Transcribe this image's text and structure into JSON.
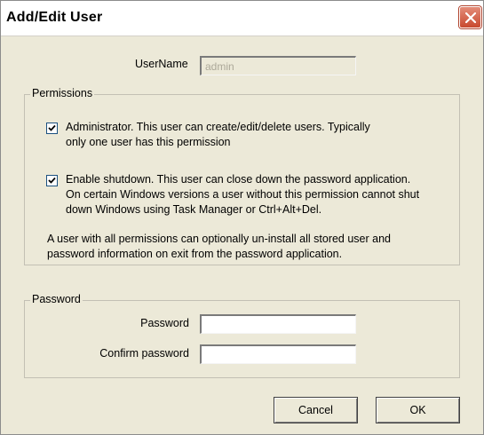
{
  "window": {
    "title": "Add/Edit User"
  },
  "username": {
    "label": "UserName",
    "value": "admin"
  },
  "permissions": {
    "caption": "Permissions",
    "administrator": {
      "checked": true,
      "line1": "Administrator.  This user can create/edit/delete users.  Typically",
      "line2": "only one user has this permission"
    },
    "shutdown": {
      "checked": true,
      "line1": "Enable shutdown.  This user can close down the password application.",
      "line2": "On certain Windows versions a user without this permission cannot shut",
      "line3": "down Windows using Task Manager or Ctrl+Alt+Del."
    },
    "note_line1": "A user with all permissions can optionally un-install all stored user and",
    "note_line2": "password information on exit from the password application."
  },
  "password_group": {
    "caption": "Password",
    "password_label": "Password",
    "password_value": "",
    "confirm_label": "Confirm password",
    "confirm_value": ""
  },
  "buttons": {
    "cancel": "Cancel",
    "ok": "OK"
  },
  "icons": {
    "close": "close-icon",
    "check": "checkmark-icon"
  },
  "colors": {
    "dialog_bg": "#ECE9D8",
    "close_button": "#C8492F"
  }
}
